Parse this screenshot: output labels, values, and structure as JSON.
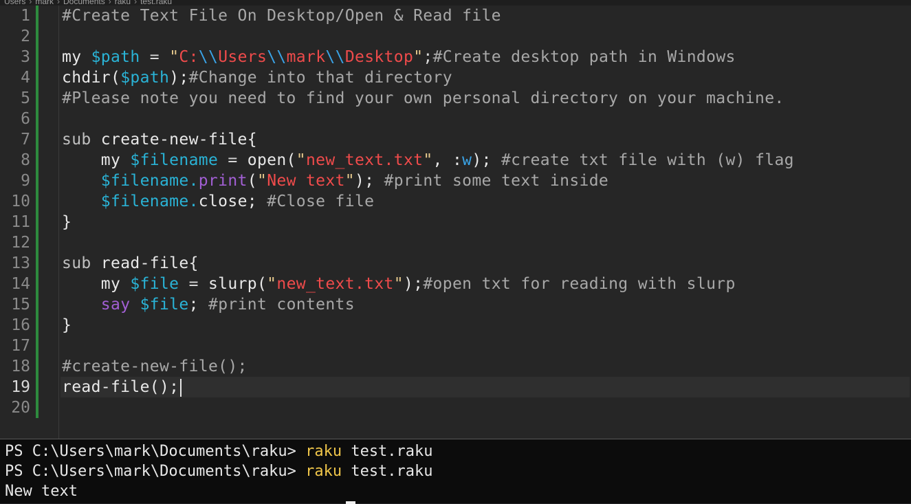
{
  "breadcrumb": [
    "Users",
    "mark",
    "Documents",
    "raku",
    "test.raku"
  ],
  "colors": {
    "comment": "#a8a8a8",
    "variable": "#2ab3d6",
    "string_literal": "#ef4b4b",
    "string_quote": "#e6c98d",
    "method": "#a25fd4",
    "change_bar": "#2e8a3e",
    "terminal_command": "#f0c64a"
  },
  "editor": {
    "active_line": 19,
    "line_numbers": [
      "1",
      "2",
      "3",
      "4",
      "5",
      "6",
      "7",
      "8",
      "9",
      "10",
      "11",
      "12",
      "13",
      "14",
      "15",
      "16",
      "17",
      "18",
      "19",
      "20"
    ],
    "lines": [
      [
        [
          "comment",
          "#Create Text File On Desktop/Open & Read file"
        ]
      ],
      [],
      [
        [
          "kw",
          "my "
        ],
        [
          "var",
          "$path"
        ],
        [
          "op",
          " = "
        ],
        [
          "str",
          "\""
        ],
        [
          "strc",
          "C:"
        ],
        [
          "esc",
          "\\\\"
        ],
        [
          "strc",
          "Users"
        ],
        [
          "esc",
          "\\\\"
        ],
        [
          "strc",
          "mark"
        ],
        [
          "esc",
          "\\\\"
        ],
        [
          "strc",
          "Desktop"
        ],
        [
          "str",
          "\""
        ],
        [
          "op",
          ";"
        ],
        [
          "comment",
          "#Create desktop path in Windows"
        ]
      ],
      [
        [
          "plain",
          "chdir("
        ],
        [
          "var",
          "$path"
        ],
        [
          "plain",
          ");"
        ],
        [
          "comment",
          "#Change into that directory"
        ]
      ],
      [
        [
          "comment",
          "#Please note you need to find your own personal directory on your machine."
        ]
      ],
      [],
      [
        [
          "sub",
          "sub "
        ],
        [
          "plain",
          "create-new-file{"
        ]
      ],
      [
        [
          "plain",
          "    "
        ],
        [
          "kw",
          "my "
        ],
        [
          "var",
          "$filename"
        ],
        [
          "op",
          " = "
        ],
        [
          "plain",
          "open("
        ],
        [
          "str",
          "\""
        ],
        [
          "strc",
          "new_text.txt"
        ],
        [
          "str",
          "\""
        ],
        [
          "plain",
          ", :"
        ],
        [
          "flag",
          "w"
        ],
        [
          "plain",
          ");"
        ],
        [
          "comment",
          " #create txt file with (w) flag"
        ]
      ],
      [
        [
          "plain",
          "    "
        ],
        [
          "var",
          "$filename."
        ],
        [
          "method",
          "print"
        ],
        [
          "plain",
          "("
        ],
        [
          "str",
          "\""
        ],
        [
          "strc",
          "New text"
        ],
        [
          "str",
          "\""
        ],
        [
          "plain",
          ");"
        ],
        [
          "comment",
          " #print some text inside"
        ]
      ],
      [
        [
          "plain",
          "    "
        ],
        [
          "var",
          "$filename."
        ],
        [
          "plain",
          "close;"
        ],
        [
          "comment",
          " #Close file"
        ]
      ],
      [
        [
          "plain",
          "}"
        ]
      ],
      [],
      [
        [
          "sub",
          "sub "
        ],
        [
          "plain",
          "read-file{"
        ]
      ],
      [
        [
          "plain",
          "    "
        ],
        [
          "kw",
          "my "
        ],
        [
          "var",
          "$file"
        ],
        [
          "op",
          " = "
        ],
        [
          "plain",
          "slurp("
        ],
        [
          "str",
          "\""
        ],
        [
          "strc",
          "new_text.txt"
        ],
        [
          "str",
          "\""
        ],
        [
          "plain",
          ");"
        ],
        [
          "comment",
          "#open txt for reading with slurp"
        ]
      ],
      [
        [
          "plain",
          "    "
        ],
        [
          "method",
          "say "
        ],
        [
          "var",
          "$file"
        ],
        [
          "plain",
          ";"
        ],
        [
          "comment",
          " #print contents"
        ]
      ],
      [
        [
          "plain",
          "}"
        ]
      ],
      [],
      [
        [
          "comment",
          "#create-new-file();"
        ]
      ],
      [
        [
          "plain",
          "read-file();"
        ]
      ],
      []
    ]
  },
  "terminal": {
    "lines": [
      {
        "prompt": "PS C:\\Users\\mark\\Documents\\raku> ",
        "cmd": "raku",
        "args": " test.raku"
      },
      {
        "prompt": "PS C:\\Users\\mark\\Documents\\raku> ",
        "cmd": "raku",
        "args": " test.raku"
      },
      {
        "prompt": "New text",
        "cmd": "",
        "args": ""
      }
    ]
  }
}
